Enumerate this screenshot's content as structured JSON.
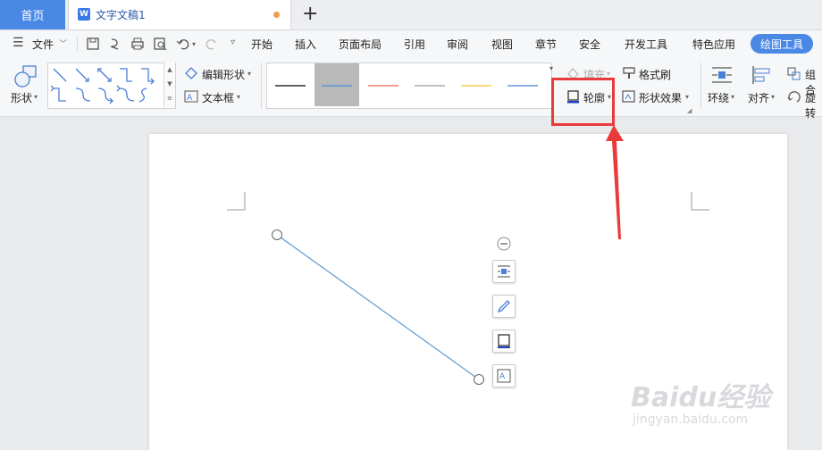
{
  "tabs": {
    "home": "首页",
    "doc_title": "文字文稿1",
    "doc_icon_letter": "W",
    "new_tab": "+"
  },
  "menu": {
    "file": "文件",
    "items": [
      "开始",
      "插入",
      "页面布局",
      "引用",
      "审阅",
      "视图",
      "章节",
      "安全",
      "开发工具",
      "特色应用"
    ],
    "active": "绘图工具"
  },
  "ribbon": {
    "shape_label": "形状",
    "edit_shape": "编辑形状",
    "text_box": "文本框",
    "fill": "填充",
    "format_painter": "格式刷",
    "outline": "轮廓",
    "shape_effects": "形状效果",
    "wrap": "环绕",
    "align": "对齐",
    "group": "组合",
    "rotate": "旋转",
    "line_style_colors": [
      "#000000",
      "#4a90e2",
      "#e8674a",
      "#9a9a9a",
      "#f2c230",
      "#4a7fd6"
    ]
  },
  "colors": {
    "accent": "#4a88e6",
    "highlight": "#ea3b3b",
    "line": "#5b9bd5"
  },
  "watermark": {
    "brand": "Baidu经验",
    "url": "jingyan.baidu.com"
  }
}
